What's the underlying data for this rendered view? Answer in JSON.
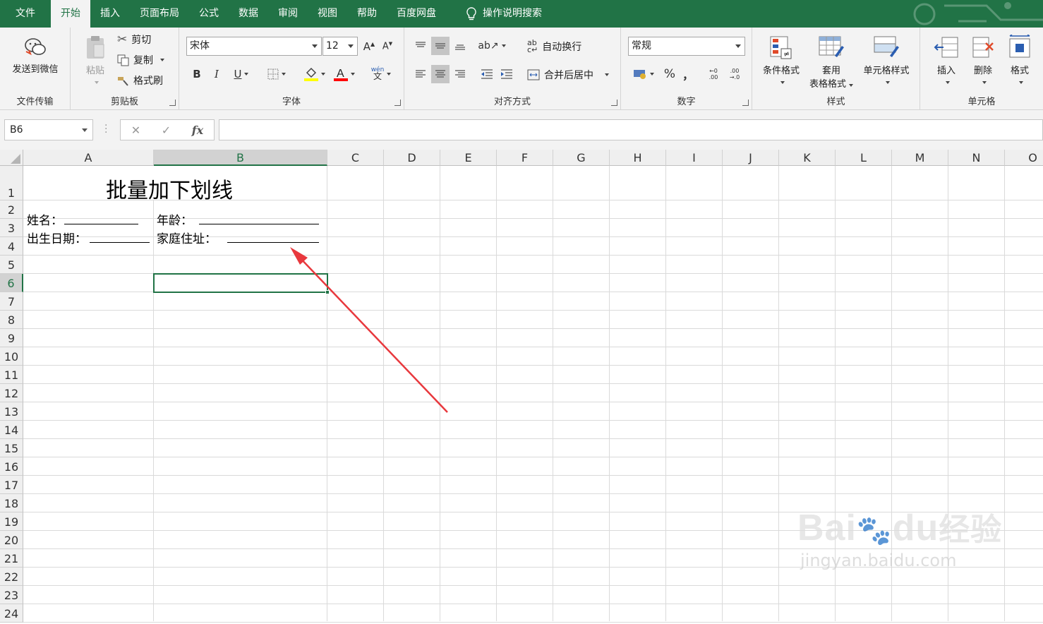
{
  "tabs": {
    "file": "文件",
    "home": "开始",
    "insert": "插入",
    "layout": "页面布局",
    "formula": "公式",
    "data": "数据",
    "review": "审阅",
    "view": "视图",
    "help": "帮助",
    "baidu": "百度网盘",
    "search": "操作说明搜索"
  },
  "ribbon": {
    "transfer": {
      "send_label": "发送到微信",
      "group_label": "文件传输"
    },
    "clipboard": {
      "paste_label": "粘贴",
      "cut_label": "剪切",
      "copy_label": "复制",
      "format_painter_label": "格式刷",
      "group_label": "剪贴板"
    },
    "font": {
      "font_name": "宋体",
      "font_size": "12",
      "bold": "B",
      "italic": "I",
      "underline": "U",
      "wen": "wén",
      "wen_char": "文",
      "group_label": "字体"
    },
    "alignment": {
      "wrap_label": "自动换行",
      "merge_label": "合并后居中",
      "group_label": "对齐方式"
    },
    "number": {
      "format": "常规",
      "percent": "%",
      "comma": "，",
      "group_label": "数字"
    },
    "styles": {
      "conditional_label": "条件格式",
      "table_label_1": "套用",
      "table_label_2": "表格格式",
      "cell_style_label": "单元格样式",
      "group_label": "样式"
    },
    "cells": {
      "insert_label": "插入",
      "delete_label": "删除",
      "format_label": "格式",
      "group_label": "单元格"
    }
  },
  "formula_bar": {
    "name_box": "B6",
    "fx": "fx",
    "value": ""
  },
  "columns": [
    "A",
    "B",
    "C",
    "D",
    "E",
    "F",
    "G",
    "H",
    "I",
    "J",
    "K",
    "L",
    "M",
    "N",
    "O"
  ],
  "rows": [
    "1",
    "2",
    "3",
    "4",
    "5",
    "6",
    "7",
    "8",
    "9",
    "10",
    "11",
    "12",
    "13",
    "14",
    "15",
    "16",
    "17",
    "18",
    "19",
    "20",
    "21",
    "22",
    "23",
    "24"
  ],
  "selected_cell": "B6",
  "cells": {
    "title": "批量加下划线",
    "a2": "姓名：",
    "b2": "年龄：",
    "a3": "出生日期：",
    "b3": "家庭住址："
  },
  "watermark": {
    "line1": "Bai",
    "line1b": "du",
    "line1c": "经验",
    "line2": "jingyan.baidu.com"
  },
  "colors": {
    "excel_green": "#217346",
    "arrow_red": "#e8383d"
  }
}
